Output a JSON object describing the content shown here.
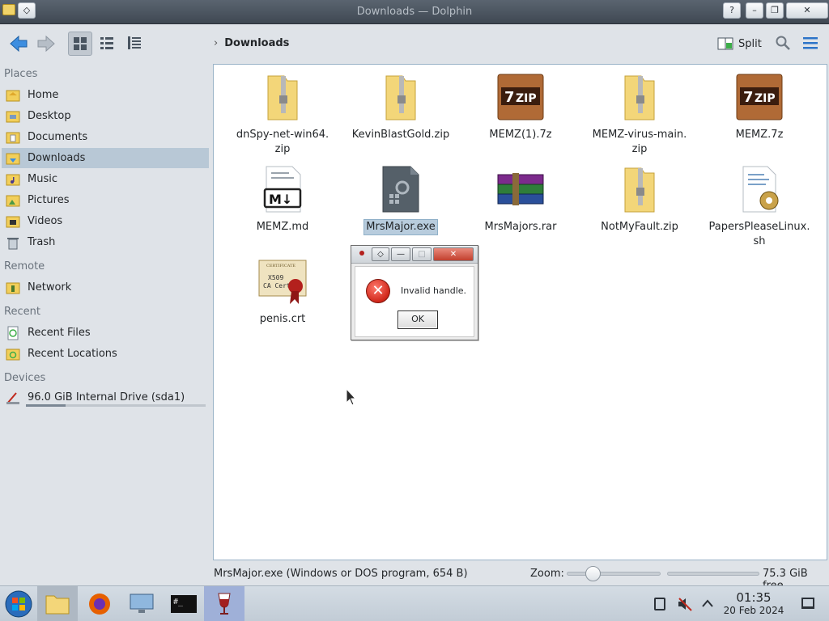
{
  "window": {
    "title": "Downloads — Dolphin",
    "help_label": "?",
    "min_label": "–",
    "max_label": "❐",
    "close_label": "✕"
  },
  "toolbar": {
    "back_icon": "arrow-left-icon",
    "forward_icon": "arrow-right-icon",
    "breadcrumb_chevron": "›",
    "breadcrumb": "Downloads",
    "split_label": "Split"
  },
  "sidebar": {
    "sections": {
      "places": "Places",
      "remote": "Remote",
      "recent": "Recent",
      "devices": "Devices"
    },
    "places": [
      {
        "label": "Home",
        "icon": "home-folder-icon"
      },
      {
        "label": "Desktop",
        "icon": "desktop-folder-icon"
      },
      {
        "label": "Documents",
        "icon": "documents-folder-icon"
      },
      {
        "label": "Downloads",
        "icon": "downloads-folder-icon",
        "selected": true
      },
      {
        "label": "Music",
        "icon": "music-folder-icon"
      },
      {
        "label": "Pictures",
        "icon": "pictures-folder-icon"
      },
      {
        "label": "Videos",
        "icon": "videos-folder-icon"
      },
      {
        "label": "Trash",
        "icon": "trash-icon"
      }
    ],
    "remote": [
      {
        "label": "Network",
        "icon": "network-icon"
      }
    ],
    "recent": [
      {
        "label": "Recent Files",
        "icon": "recent-files-icon"
      },
      {
        "label": "Recent Locations",
        "icon": "recent-locations-icon"
      }
    ],
    "devices": [
      {
        "label": "96.0 GiB Internal Drive (sda1)",
        "icon": "drive-icon",
        "usage": 0.22
      }
    ]
  },
  "files": [
    {
      "name_lines": [
        "dnSpy-net-win64.",
        "zip"
      ],
      "icon": "zip-folder-icon"
    },
    {
      "name_lines": [
        "KevinBlastGold.zip"
      ],
      "icon": "zip-folder-icon"
    },
    {
      "name_lines": [
        "MEMZ(1).7z"
      ],
      "icon": "7zip-box-icon"
    },
    {
      "name_lines": [
        "MEMZ-virus-main.",
        "zip"
      ],
      "icon": "zip-folder-icon"
    },
    {
      "name_lines": [
        "MEMZ.7z"
      ],
      "icon": "7zip-box-icon"
    },
    {
      "name_lines": [
        "MEMZ.md"
      ],
      "icon": "markdown-file-icon"
    },
    {
      "name_lines": [
        "MrsMajor.exe"
      ],
      "icon": "executable-file-icon",
      "selected": true
    },
    {
      "name_lines": [
        "MrsMajors.rar"
      ],
      "icon": "rar-books-icon"
    },
    {
      "name_lines": [
        "NotMyFault.zip"
      ],
      "icon": "zip-folder-icon"
    },
    {
      "name_lines": [
        "PapersPleaseLinux.",
        "sh"
      ],
      "icon": "shell-script-icon"
    },
    {
      "name_lines": [
        "penis.crt"
      ],
      "icon": "certificate-icon"
    }
  ],
  "icon_text": {
    "seven_zip": "ZIP",
    "seven": "7",
    "markdown": "M↓",
    "cert_top": "CERTIFICATE",
    "cert_mid": "X509",
    "cert_bot": "CA Cert"
  },
  "dialog": {
    "message": "Invalid handle.",
    "ok_label": "OK",
    "error_glyph": "✕",
    "min_label": "—",
    "max_label": "□",
    "close_label": "✕",
    "pin_label": "◇"
  },
  "statusbar": {
    "info": "MrsMajor.exe (Windows or DOS program, 654 B)",
    "zoom_label": "Zoom:",
    "zoom_level": 0.2,
    "free_space": "75.3 GiB free"
  },
  "taskbar": {
    "apps": [
      {
        "name": "start-button",
        "icon": "windows-orb-icon"
      },
      {
        "name": "file-manager",
        "icon": "folder-icon",
        "state": "active"
      },
      {
        "name": "firefox",
        "icon": "firefox-icon"
      },
      {
        "name": "system-settings",
        "icon": "settings-monitor-icon"
      },
      {
        "name": "terminal",
        "icon": "terminal-icon"
      },
      {
        "name": "wine",
        "icon": "wine-glass-icon",
        "state": "running"
      }
    ],
    "terminal_text": "#_",
    "time": "01:35",
    "date": "20 Feb 2024"
  }
}
